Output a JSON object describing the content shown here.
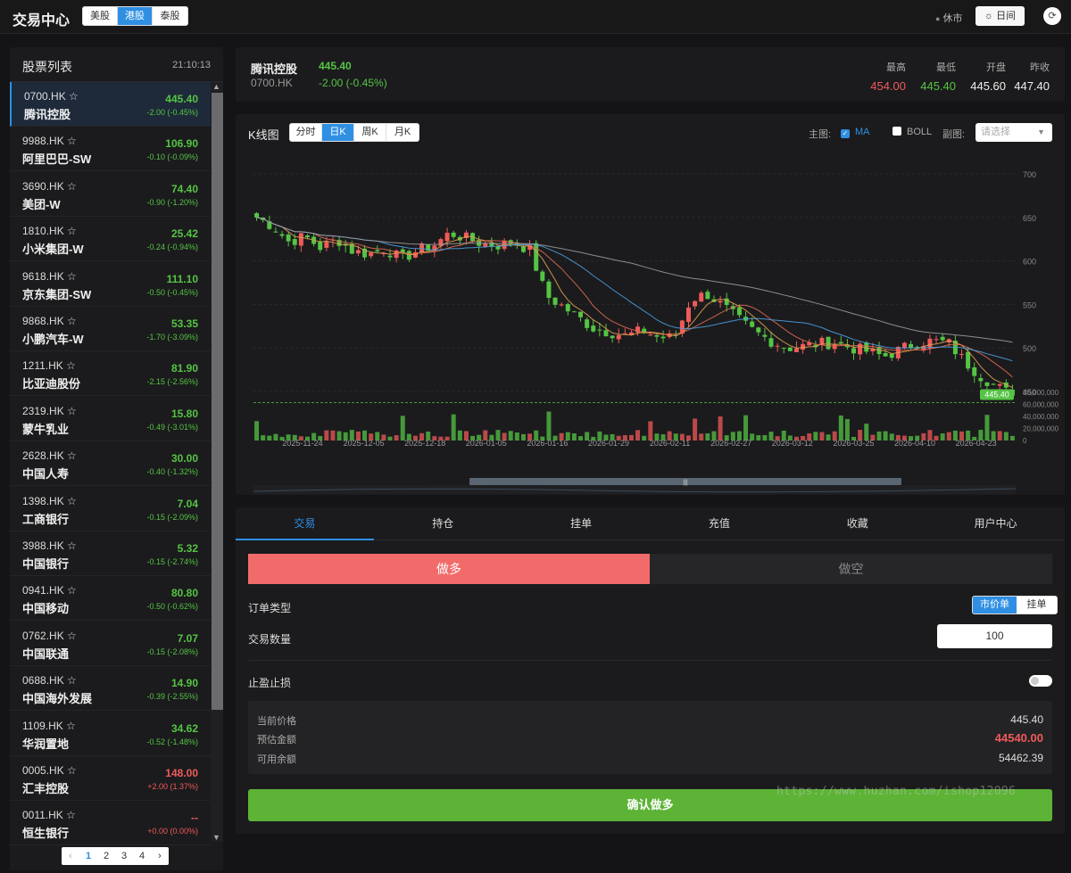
{
  "header": {
    "title": "交易中心",
    "markets": [
      "美股",
      "港股",
      "泰股"
    ],
    "active_market": 1,
    "market_status": "休市",
    "day_button": "日间",
    "refresh_glyph": "⟳",
    "icons": [
      "refresh-icon",
      "sun-icon"
    ]
  },
  "stock_list": {
    "title": "股票列表",
    "time": "21:10:13",
    "selected": 0,
    "items": [
      {
        "code": "0700.HK ☆",
        "name": "腾讯控股",
        "price": "445.40",
        "change": "-2.00 (-0.45%)",
        "up": false
      },
      {
        "code": "9988.HK ☆",
        "name": "阿里巴巴-SW",
        "price": "106.90",
        "change": "-0.10 (-0.09%)",
        "up": false
      },
      {
        "code": "3690.HK ☆",
        "name": "美团-W",
        "price": "74.40",
        "change": "-0.90 (-1.20%)",
        "up": false
      },
      {
        "code": "1810.HK ☆",
        "name": "小米集团-W",
        "price": "25.42",
        "change": "-0.24 (-0.94%)",
        "up": false
      },
      {
        "code": "9618.HK ☆",
        "name": "京东集团-SW",
        "price": "111.10",
        "change": "-0.50 (-0.45%)",
        "up": false
      },
      {
        "code": "9868.HK ☆",
        "name": "小鹏汽车-W",
        "price": "53.35",
        "change": "-1.70 (-3.09%)",
        "up": false
      },
      {
        "code": "1211.HK ☆",
        "name": "比亚迪股份",
        "price": "81.90",
        "change": "-2.15 (-2.56%)",
        "up": false
      },
      {
        "code": "2319.HK ☆",
        "name": "蒙牛乳业",
        "price": "15.80",
        "change": "-0.49 (-3.01%)",
        "up": false
      },
      {
        "code": "2628.HK ☆",
        "name": "中国人寿",
        "price": "30.00",
        "change": "-0.40 (-1.32%)",
        "up": false
      },
      {
        "code": "1398.HK ☆",
        "name": "工商银行",
        "price": "7.04",
        "change": "-0.15 (-2.09%)",
        "up": false
      },
      {
        "code": "3988.HK ☆",
        "name": "中国银行",
        "price": "5.32",
        "change": "-0.15 (-2.74%)",
        "up": false
      },
      {
        "code": "0941.HK ☆",
        "name": "中国移动",
        "price": "80.80",
        "change": "-0.50 (-0.62%)",
        "up": false
      },
      {
        "code": "0762.HK ☆",
        "name": "中国联通",
        "price": "7.07",
        "change": "-0.15 (-2.08%)",
        "up": false
      },
      {
        "code": "0688.HK ☆",
        "name": "中国海外发展",
        "price": "14.90",
        "change": "-0.39 (-2.55%)",
        "up": false
      },
      {
        "code": "1109.HK ☆",
        "name": "华润置地",
        "price": "34.62",
        "change": "-0.52 (-1.48%)",
        "up": false
      },
      {
        "code": "0005.HK ☆",
        "name": "汇丰控股",
        "price": "148.00",
        "change": "+2.00 (1.37%)",
        "up": true
      },
      {
        "code": "0011.HK ☆",
        "name": "恒生银行",
        "price": "--",
        "change": "+0.00 (0.00%)",
        "up": true
      }
    ],
    "pager": [
      "‹",
      "1",
      "2",
      "3",
      "4",
      "›"
    ],
    "current_page": 1
  },
  "quote": {
    "name": "腾讯控股",
    "code": "0700.HK",
    "price": "445.40",
    "change": "-2.00 (-0.45%)",
    "stats": [
      {
        "label": "最高",
        "value": "454.00",
        "color": "#f05a5a"
      },
      {
        "label": "最低",
        "value": "445.40",
        "color": "#55c444"
      },
      {
        "label": "开盘",
        "value": "445.60",
        "color": "#eeeeee"
      },
      {
        "label": "昨收",
        "value": "447.40",
        "color": "#eeeeee"
      }
    ]
  },
  "kline": {
    "title": "K线图",
    "periods": [
      "分时",
      "日K",
      "周K",
      "月K"
    ],
    "active_period": 1,
    "main_label": "主图:",
    "ma_label": "MA",
    "boll_label": "BOLL",
    "sub_label": "副图:",
    "sub_placeholder": "请选择",
    "price_ticks": [
      "700",
      "650",
      "600",
      "550",
      "500",
      "450"
    ],
    "volume_ticks": [
      "80,000,000",
      "60,000,000",
      "40,000,000",
      "20,000,000",
      "0"
    ],
    "dates": [
      "2025-11-24",
      "2025-12-05",
      "2025-12-18",
      "2026-01-05",
      "2026-01-16",
      "2026-01-29",
      "2026-02-11",
      "2026-02-27",
      "2026-03-12",
      "2026-03-25",
      "2026-04-10",
      "2026-04-23"
    ],
    "last_price_tag": "445.40",
    "slider_grip": "|||"
  },
  "chart_data": {
    "type": "candlestick",
    "ylim": [
      450,
      700
    ],
    "yticks": [
      700,
      650,
      600,
      550,
      500,
      450
    ],
    "volume_ticks": [
      80000000,
      60000000,
      40000000,
      20000000,
      0
    ],
    "x_ticks": [
      "2025-11-24",
      "2025-12-05",
      "2025-12-18",
      "2026-01-05",
      "2026-01-16",
      "2026-01-29",
      "2026-02-11",
      "2026-02-27",
      "2026-03-12",
      "2026-03-25",
      "2026-04-10",
      "2026-04-23"
    ],
    "last_price": 445.4,
    "overlays": [
      "MA"
    ],
    "anchor_closes": [
      650,
      640,
      622,
      628,
      615,
      625,
      611,
      608,
      614,
      602,
      612,
      618,
      632,
      626,
      620,
      618,
      622,
      612,
      560,
      548,
      535,
      522,
      518,
      514,
      520,
      512,
      512,
      556,
      562,
      548,
      532,
      518,
      508,
      500,
      502,
      505,
      506,
      500,
      496,
      490,
      498,
      506,
      508,
      506,
      485,
      468,
      456,
      445.4
    ],
    "colors": {
      "up": "#f05a5a",
      "down": "#55c444",
      "ma5": "#e0a050",
      "ma10": "#e06a50",
      "ma20": "#4a9ee0",
      "ma60": "#9a9a9a"
    }
  },
  "trade": {
    "tabs": [
      "交易",
      "持仓",
      "挂单",
      "充值",
      "收藏",
      "用户中心"
    ],
    "active_tab": 0,
    "long_label": "做多",
    "short_label": "做空",
    "order_type_label": "订单类型",
    "order_types": [
      "市价单",
      "挂单"
    ],
    "active_order_type": 0,
    "qty_label": "交易数量",
    "qty_value": "100",
    "tp_sl_label": "止盈止损",
    "tp_sl_enabled": false,
    "summary": [
      {
        "label": "当前价格",
        "value": "445.40",
        "color": "#dddddd",
        "bold": false
      },
      {
        "label": "预估金额",
        "value": "44540.00",
        "color": "#f05a5a",
        "bold": true
      },
      {
        "label": "可用余额",
        "value": "54462.39",
        "color": "#dddddd",
        "bold": false
      }
    ],
    "confirm_label": "确认做多"
  },
  "watermark": "https://www.huzhan.com/ishop12096"
}
